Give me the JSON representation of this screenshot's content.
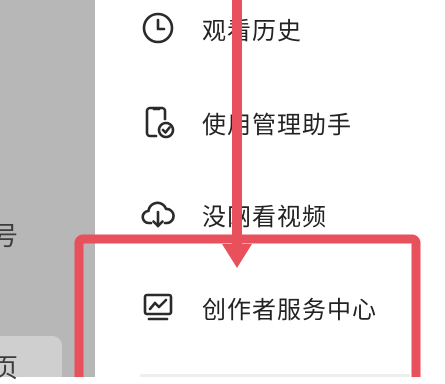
{
  "background": {
    "fragments": [
      "号",
      "页"
    ]
  },
  "menu": {
    "items": [
      {
        "label": "观看历史",
        "icon": "clock-icon"
      },
      {
        "label": "使用管理助手",
        "icon": "phone-shield-icon"
      },
      {
        "label": "没网看视频",
        "icon": "cloud-download-icon"
      },
      {
        "label": "创作者服务中心",
        "icon": "creator-chart-icon"
      }
    ]
  },
  "annotation": {
    "color": "#e8505b"
  }
}
